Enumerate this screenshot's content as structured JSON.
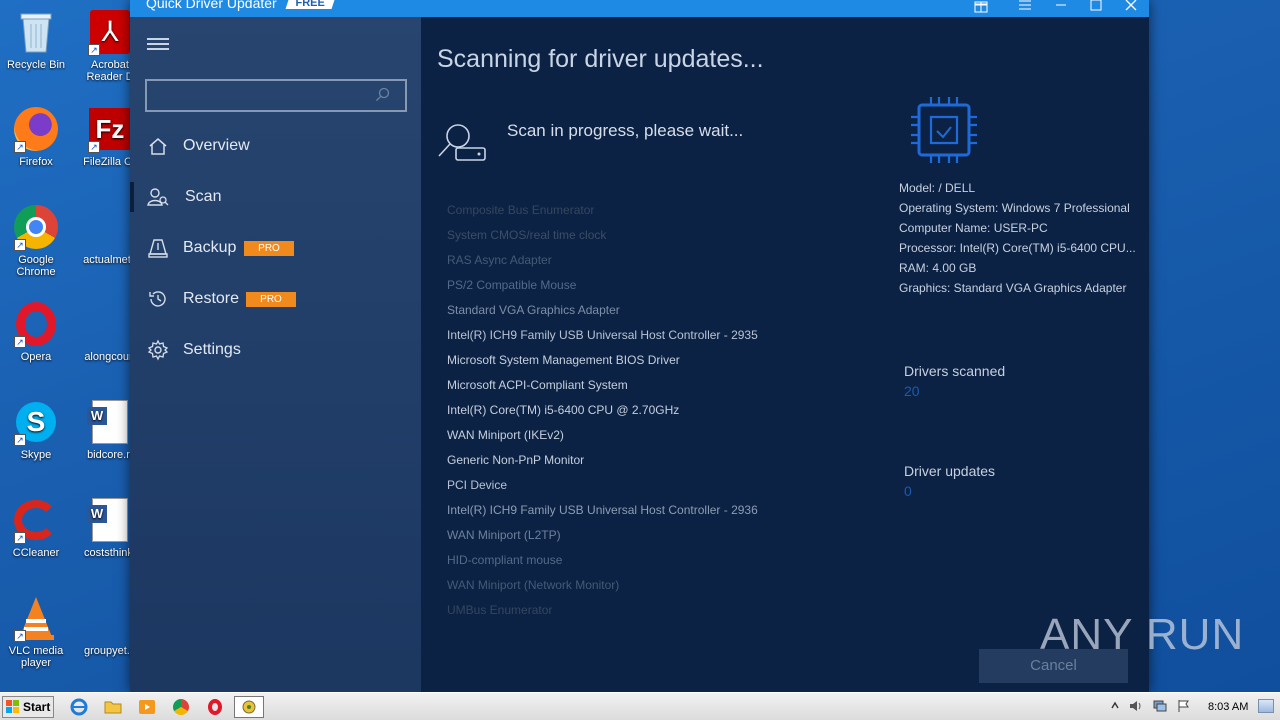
{
  "desktop": {
    "icons": [
      {
        "label": "Recycle Bin"
      },
      {
        "label": "Acrobat Reader D"
      },
      {
        "label": "Firefox"
      },
      {
        "label": "FileZilla Cli"
      },
      {
        "label": "Google Chrome"
      },
      {
        "label": "actualmeta"
      },
      {
        "label": "Opera"
      },
      {
        "label": "alongcourt"
      },
      {
        "label": "Skype"
      },
      {
        "label": "bidcore.rt"
      },
      {
        "label": "CCleaner"
      },
      {
        "label": "coststhink."
      },
      {
        "label": "VLC media player"
      },
      {
        "label": "groupyet.p"
      }
    ]
  },
  "window": {
    "title": "Quick Driver Updater",
    "badge": "FREE"
  },
  "sidebar": {
    "search_placeholder": "",
    "items": [
      {
        "label": "Overview"
      },
      {
        "label": "Scan"
      },
      {
        "label": "Backup",
        "badge": "PRO"
      },
      {
        "label": "Restore",
        "badge": "PRO"
      },
      {
        "label": "Settings"
      }
    ]
  },
  "main": {
    "heading": "Scanning for driver updates...",
    "status": "Scan in progress, please wait...",
    "drivers": [
      "Composite Bus Enumerator",
      "System CMOS/real time clock",
      "RAS Async Adapter",
      "PS/2 Compatible Mouse",
      "Standard VGA Graphics Adapter",
      "Intel(R) ICH9 Family USB Universal Host Controller - 2935",
      "Microsoft System Management BIOS Driver",
      "Microsoft ACPI-Compliant System",
      "Intel(R) Core(TM) i5-6400 CPU @ 2.70GHz",
      "WAN Miniport (IKEv2)",
      "Generic Non-PnP Monitor",
      "PCI Device",
      "Intel(R) ICH9 Family USB Universal Host Controller - 2936",
      "WAN Miniport (L2TP)",
      "HID-compliant mouse",
      "WAN Miniport (Network Monitor)",
      "UMBus Enumerator"
    ],
    "driver_colors": [
      "#34475f",
      "#3a4e67",
      "#455a75",
      "#54698a",
      "#7d8ea8",
      "#b8c3d3",
      "#c5cfdd",
      "#c5cfdd",
      "#c5cfdd",
      "#c5cfdd",
      "#c5cfdd",
      "#b8c3d3",
      "#8c9cb4",
      "#6e809c",
      "#556a89",
      "#455a75",
      "#34475f"
    ],
    "system_info": {
      "model": "Model:  / DELL",
      "os": "Operating System: Windows 7 Professional",
      "computer": "Computer Name: USER-PC",
      "processor": " Processor: Intel(R) Core(TM) i5-6400 CPU...",
      "ram": "RAM: 4.00 GB",
      "graphics": "Graphics: Standard VGA Graphics Adapter"
    },
    "drivers_scanned_label": "Drivers scanned",
    "drivers_scanned_value": "20",
    "driver_updates_label": "Driver updates",
    "driver_updates_value": "0",
    "cancel_label": "Cancel"
  },
  "watermark": "ANY RUN",
  "taskbar": {
    "start_label": "Start",
    "clock": "8:03 AM"
  }
}
